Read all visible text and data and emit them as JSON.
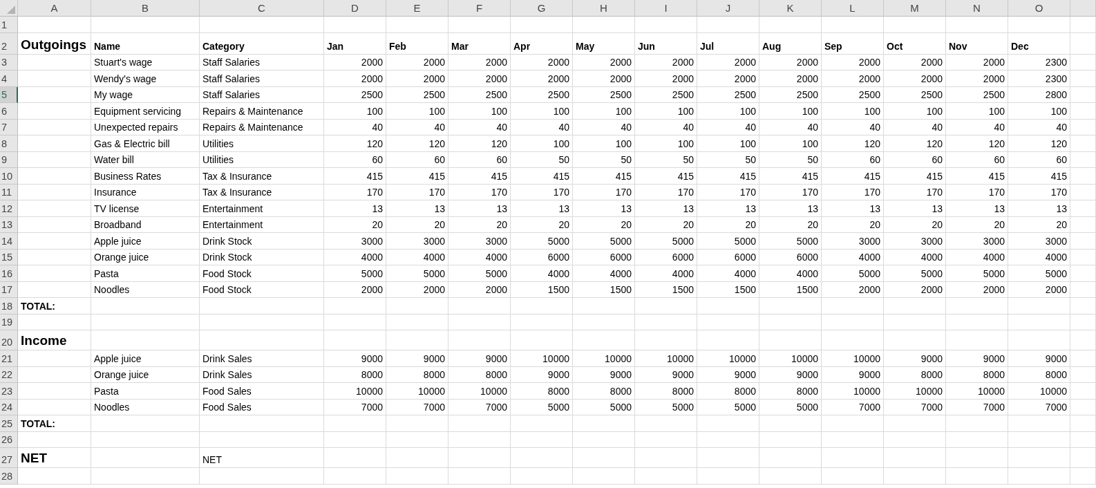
{
  "columns": [
    "A",
    "B",
    "C",
    "D",
    "E",
    "F",
    "G",
    "H",
    "I",
    "J",
    "K",
    "L",
    "M",
    "N",
    "O"
  ],
  "rows": [
    {
      "number": "1",
      "kind": "blank",
      "selected": false
    },
    {
      "number": "2",
      "kind": "header",
      "selected": false,
      "section": "Outgoings",
      "name": "Name",
      "category": "Category",
      "months": [
        "Jan",
        "Feb",
        "Mar",
        "Apr",
        "May",
        "Jun",
        "Jul",
        "Aug",
        "Sep",
        "Oct",
        "Nov",
        "Dec"
      ]
    },
    {
      "number": "3",
      "kind": "item",
      "selected": false,
      "name": "Stuart's wage",
      "category": "Staff Salaries",
      "values": [
        "2000",
        "2000",
        "2000",
        "2000",
        "2000",
        "2000",
        "2000",
        "2000",
        "2000",
        "2000",
        "2000",
        "2300"
      ]
    },
    {
      "number": "4",
      "kind": "item",
      "selected": false,
      "name": "Wendy's wage",
      "category": "Staff Salaries",
      "values": [
        "2000",
        "2000",
        "2000",
        "2000",
        "2000",
        "2000",
        "2000",
        "2000",
        "2000",
        "2000",
        "2000",
        "2300"
      ]
    },
    {
      "number": "5",
      "kind": "item",
      "selected": true,
      "name": "My wage",
      "category": "Staff Salaries",
      "values": [
        "2500",
        "2500",
        "2500",
        "2500",
        "2500",
        "2500",
        "2500",
        "2500",
        "2500",
        "2500",
        "2500",
        "2800"
      ]
    },
    {
      "number": "6",
      "kind": "item",
      "selected": false,
      "name": "Equipment servicing",
      "category": "Repairs & Maintenance",
      "values": [
        "100",
        "100",
        "100",
        "100",
        "100",
        "100",
        "100",
        "100",
        "100",
        "100",
        "100",
        "100"
      ]
    },
    {
      "number": "7",
      "kind": "item",
      "selected": false,
      "name": "Unexpected repairs",
      "category": "Repairs & Maintenance",
      "values": [
        "40",
        "40",
        "40",
        "40",
        "40",
        "40",
        "40",
        "40",
        "40",
        "40",
        "40",
        "40"
      ]
    },
    {
      "number": "8",
      "kind": "item",
      "selected": false,
      "name": "Gas & Electric bill",
      "category": "Utilities",
      "values": [
        "120",
        "120",
        "120",
        "100",
        "100",
        "100",
        "100",
        "100",
        "120",
        "120",
        "120",
        "120"
      ]
    },
    {
      "number": "9",
      "kind": "item",
      "selected": false,
      "name": "Water bill",
      "category": "Utilities",
      "values": [
        "60",
        "60",
        "60",
        "50",
        "50",
        "50",
        "50",
        "50",
        "60",
        "60",
        "60",
        "60"
      ]
    },
    {
      "number": "10",
      "kind": "item",
      "selected": false,
      "name": "Business Rates",
      "category": "Tax & Insurance",
      "values": [
        "415",
        "415",
        "415",
        "415",
        "415",
        "415",
        "415",
        "415",
        "415",
        "415",
        "415",
        "415"
      ]
    },
    {
      "number": "11",
      "kind": "item",
      "selected": false,
      "name": "Insurance",
      "category": "Tax & Insurance",
      "values": [
        "170",
        "170",
        "170",
        "170",
        "170",
        "170",
        "170",
        "170",
        "170",
        "170",
        "170",
        "170"
      ]
    },
    {
      "number": "12",
      "kind": "item",
      "selected": false,
      "name": "TV license",
      "category": "Entertainment",
      "values": [
        "13",
        "13",
        "13",
        "13",
        "13",
        "13",
        "13",
        "13",
        "13",
        "13",
        "13",
        "13"
      ]
    },
    {
      "number": "13",
      "kind": "item",
      "selected": false,
      "name": "Broadband",
      "category": "Entertainment",
      "values": [
        "20",
        "20",
        "20",
        "20",
        "20",
        "20",
        "20",
        "20",
        "20",
        "20",
        "20",
        "20"
      ]
    },
    {
      "number": "14",
      "kind": "item",
      "selected": false,
      "name": "Apple juice",
      "category": "Drink Stock",
      "values": [
        "3000",
        "3000",
        "3000",
        "5000",
        "5000",
        "5000",
        "5000",
        "5000",
        "3000",
        "3000",
        "3000",
        "3000"
      ]
    },
    {
      "number": "15",
      "kind": "item",
      "selected": false,
      "name": "Orange juice",
      "category": "Drink Stock",
      "values": [
        "4000",
        "4000",
        "4000",
        "6000",
        "6000",
        "6000",
        "6000",
        "6000",
        "4000",
        "4000",
        "4000",
        "4000"
      ]
    },
    {
      "number": "16",
      "kind": "item",
      "selected": false,
      "name": "Pasta",
      "category": "Food Stock",
      "values": [
        "5000",
        "5000",
        "5000",
        "4000",
        "4000",
        "4000",
        "4000",
        "4000",
        "5000",
        "5000",
        "5000",
        "5000"
      ]
    },
    {
      "number": "17",
      "kind": "item",
      "selected": false,
      "name": "Noodles",
      "category": "Food Stock",
      "values": [
        "2000",
        "2000",
        "2000",
        "1500",
        "1500",
        "1500",
        "1500",
        "1500",
        "2000",
        "2000",
        "2000",
        "2000"
      ]
    },
    {
      "number": "18",
      "kind": "total",
      "selected": false,
      "label": "TOTAL:"
    },
    {
      "number": "19",
      "kind": "blank",
      "selected": false
    },
    {
      "number": "20",
      "kind": "section",
      "selected": false,
      "section": "Income"
    },
    {
      "number": "21",
      "kind": "item",
      "selected": false,
      "name": "Apple juice",
      "category": "Drink Sales",
      "values": [
        "9000",
        "9000",
        "9000",
        "10000",
        "10000",
        "10000",
        "10000",
        "10000",
        "10000",
        "9000",
        "9000",
        "9000"
      ]
    },
    {
      "number": "22",
      "kind": "item",
      "selected": false,
      "name": "Orange juice",
      "category": "Drink Sales",
      "values": [
        "8000",
        "8000",
        "8000",
        "9000",
        "9000",
        "9000",
        "9000",
        "9000",
        "9000",
        "8000",
        "8000",
        "8000"
      ]
    },
    {
      "number": "23",
      "kind": "item",
      "selected": false,
      "name": "Pasta",
      "category": "Food Sales",
      "values": [
        "10000",
        "10000",
        "10000",
        "8000",
        "8000",
        "8000",
        "8000",
        "8000",
        "10000",
        "10000",
        "10000",
        "10000"
      ]
    },
    {
      "number": "24",
      "kind": "item",
      "selected": false,
      "name": "Noodles",
      "category": "Food Sales",
      "values": [
        "7000",
        "7000",
        "7000",
        "5000",
        "5000",
        "5000",
        "5000",
        "5000",
        "7000",
        "7000",
        "7000",
        "7000"
      ]
    },
    {
      "number": "25",
      "kind": "total",
      "selected": false,
      "label": "TOTAL:"
    },
    {
      "number": "26",
      "kind": "blank",
      "selected": false
    },
    {
      "number": "27",
      "kind": "net",
      "selected": false,
      "section": "NET",
      "category": "NET"
    },
    {
      "number": "28",
      "kind": "blank",
      "selected": false
    }
  ]
}
